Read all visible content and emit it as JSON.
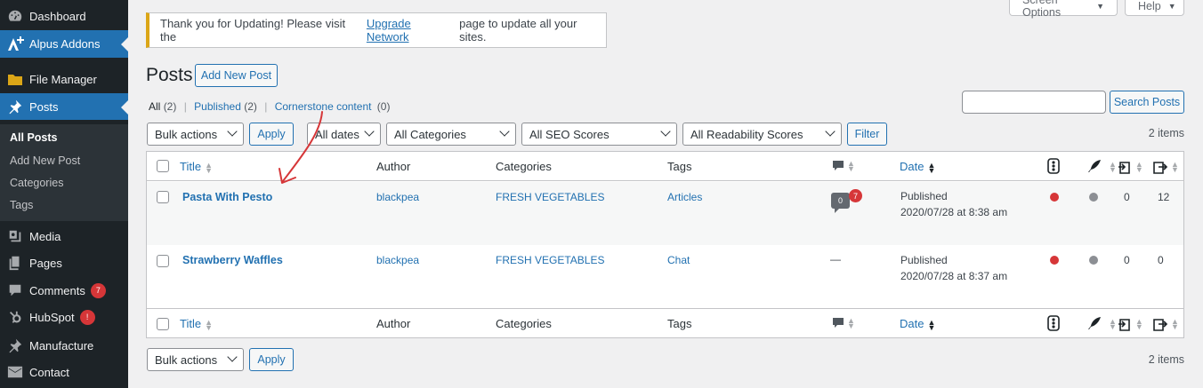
{
  "sidebar": {
    "items": [
      {
        "label": "Dashboard",
        "icon": "dashboard-icon"
      },
      {
        "label": "Alpus Addons",
        "icon": "alpus-addons-icon",
        "active": true
      },
      {
        "label": "File Manager",
        "icon": "folder-icon"
      },
      {
        "label": "Posts",
        "icon": "pushpin-icon",
        "active": true
      },
      {
        "label": "Media",
        "icon": "media-icon"
      },
      {
        "label": "Pages",
        "icon": "pages-icon"
      },
      {
        "label": "Comments",
        "icon": "comment-icon",
        "badge": "7"
      },
      {
        "label": "HubSpot",
        "icon": "hubspot-icon",
        "badge": "!"
      },
      {
        "label": "Manufacture",
        "icon": "pushpin-icon"
      },
      {
        "label": "Contact",
        "icon": "mail-icon"
      }
    ],
    "submenu": [
      "All Posts",
      "Add New Post",
      "Categories",
      "Tags"
    ]
  },
  "screen_options": {
    "label": "Screen Options",
    "help": "Help"
  },
  "notice": {
    "before": "Thank you for Updating! Please visit the",
    "link": "Upgrade Network",
    "after": "page to update all your sites."
  },
  "page": {
    "title": "Posts",
    "add_new": "Add New Post"
  },
  "views": {
    "all": "All",
    "all_count": "(2)",
    "published": "Published",
    "published_count": "(2)",
    "cornerstone": "Cornerstone content",
    "cornerstone_count": "(0)",
    "sep": "|"
  },
  "search": {
    "button": "Search Posts",
    "value": ""
  },
  "filters": {
    "bulk_actions": "Bulk actions",
    "apply": "Apply",
    "dates": "All dates",
    "categories": "All Categories",
    "seo": "All SEO Scores",
    "readability": "All Readability Scores",
    "filter": "Filter",
    "items_count": "2 items"
  },
  "table": {
    "headers": {
      "title": "Title",
      "author": "Author",
      "categories": "Categories",
      "tags": "Tags",
      "date": "Date"
    },
    "rows": [
      {
        "title": "Pasta With Pesto",
        "author": "blackpea",
        "category": "FRESH VEGETABLES",
        "tag": "Articles",
        "comments": "0",
        "pending": "7",
        "status": "Published",
        "date": "2020/07/28 at 8:38 am",
        "seo_color": "#d63638",
        "readability_color": "#8c8f94",
        "links_in": "0",
        "links_out": "12"
      },
      {
        "title": "Strawberry Waffles",
        "author": "blackpea",
        "category": "FRESH VEGETABLES",
        "tag": "Chat",
        "comments": "—",
        "status": "Published",
        "date": "2020/07/28 at 8:37 am",
        "seo_color": "#d63638",
        "readability_color": "#8c8f94",
        "links_in": "0",
        "links_out": "0"
      }
    ]
  },
  "annotation": {
    "type": "red-arrow",
    "color": "#d63638"
  }
}
